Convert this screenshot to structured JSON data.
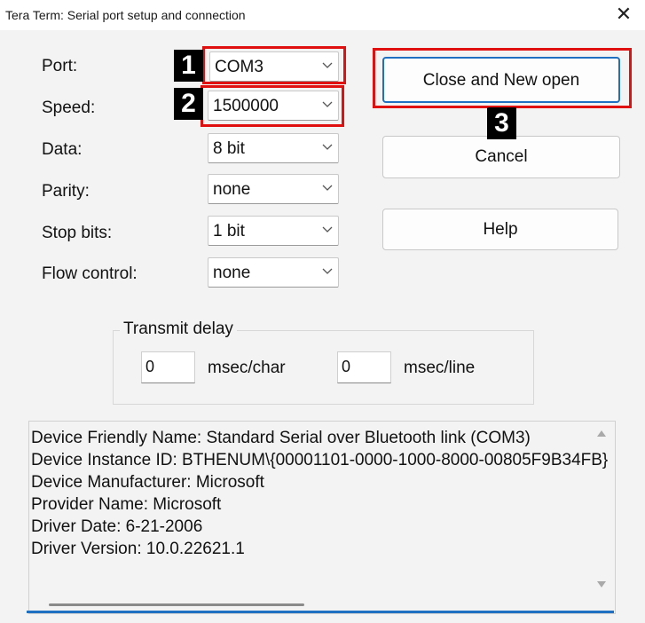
{
  "window": {
    "title": "Tera Term: Serial port setup and connection",
    "close_glyph": "✕"
  },
  "fields": [
    {
      "label": "Port:",
      "value": "COM3"
    },
    {
      "label": "Speed:",
      "value": "1500000"
    },
    {
      "label": "Data:",
      "value": "8 bit"
    },
    {
      "label": "Parity:",
      "value": "none"
    },
    {
      "label": "Stop bits:",
      "value": "1 bit"
    },
    {
      "label": "Flow control:",
      "value": "none"
    }
  ],
  "buttons": {
    "close_new_open": "Close and New open",
    "cancel": "Cancel",
    "help": "Help"
  },
  "transmit_delay": {
    "title": "Transmit delay",
    "char_value": "0",
    "char_unit": "msec/char",
    "line_value": "0",
    "line_unit": "msec/line"
  },
  "device_info": [
    "Device Friendly Name: Standard Serial over Bluetooth link (COM3)",
    "Device Instance ID: BTHENUM\\{00001101-0000-1000-8000-00805F9B34FB}",
    "Device Manufacturer: Microsoft",
    "Provider Name: Microsoft",
    "Driver Date: 6-21-2006",
    "Driver Version: 10.0.22621.1"
  ],
  "annotations": [
    "1",
    "2",
    "3"
  ],
  "colors": {
    "highlight_red": "#e01010",
    "badge_black": "#000000",
    "focus_blue": "#1f6fc2"
  },
  "icons": [
    "close-icon",
    "chevron-down-icon",
    "scroll-up-icon",
    "scroll-down-icon"
  ]
}
